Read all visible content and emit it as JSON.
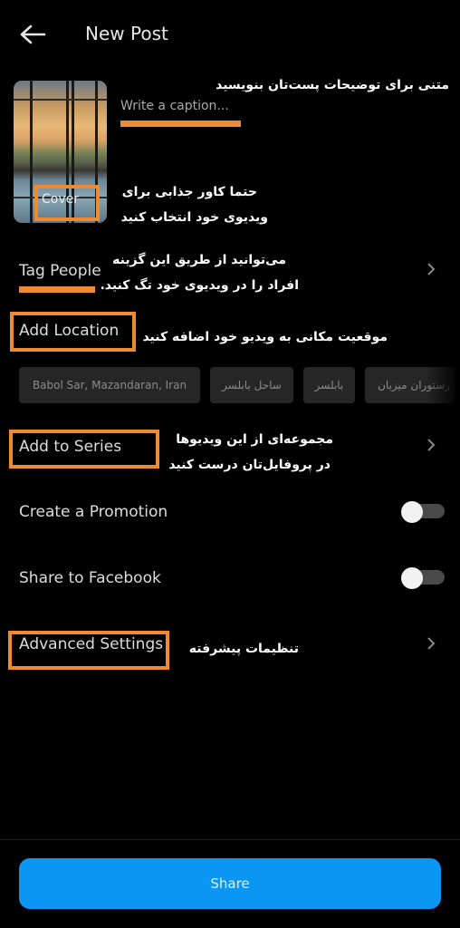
{
  "header": {
    "title": "New Post",
    "back_icon": "arrow-left-icon"
  },
  "post": {
    "cover_label": "Cover",
    "caption_placeholder": "Write a caption...",
    "caption_value": ""
  },
  "annotations": {
    "caption_hint": "متنی برای توضیحات پست‌تان بنویسید",
    "cover_hint_line1": "حتما کاور جذابی برای",
    "cover_hint_line2": "ویدیوی خود انتخاب کنید",
    "tag_hint_line1": "می‌توانید از طریق این گزینه",
    "tag_hint_line2": "افراد را در ویدیوی خود تگ کنید.",
    "location_hint": "موقعیت مکانی به ویدیو خود اضافه کنید",
    "series_hint_line1": "مجموعه‌ای از این ویدیوها",
    "series_hint_line2": "در پروفایل‌تان درست کنید",
    "advanced_hint": "تنظیمات پیشرفته",
    "highlight_color": "#f08a2e"
  },
  "settings": {
    "tag_people": {
      "label": "Tag People",
      "icon": "chevron-right-icon"
    },
    "add_location": {
      "label": "Add Location",
      "suggestions": [
        "Babol Sar, Mazandaran, Iran",
        "ساحل بابلسر",
        "بابلسر",
        "رستوران میزبان"
      ]
    },
    "add_to_series": {
      "label": "Add to Series",
      "icon": "chevron-right-icon"
    },
    "create_promotion": {
      "label": "Create a Promotion",
      "enabled": false
    },
    "share_facebook": {
      "label": "Share to Facebook",
      "enabled": false
    },
    "advanced": {
      "label": "Advanced Settings",
      "icon": "chevron-right-icon"
    }
  },
  "footer": {
    "share_label": "Share",
    "accent_color": "#0a96f2"
  }
}
